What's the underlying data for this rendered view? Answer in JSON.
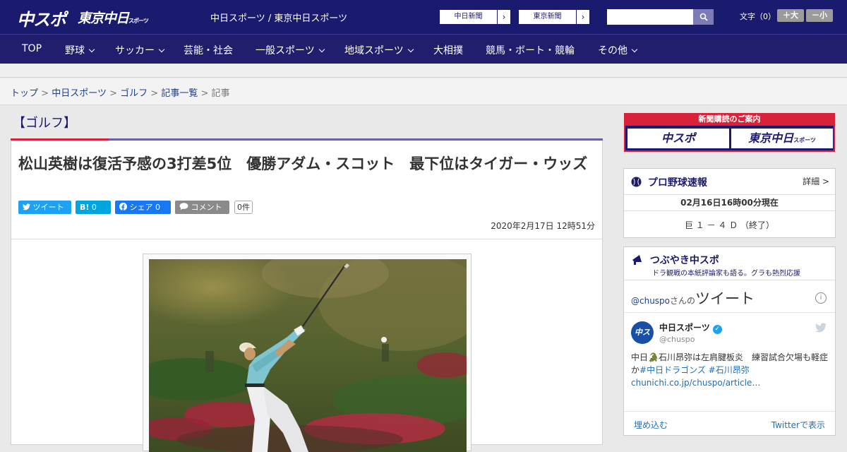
{
  "header": {
    "logo_main": "中スポ",
    "logo_tokyo": "東京中日",
    "logo_tokyo_small": "スポーツ",
    "tagline": "中日スポーツ / 東京中日スポーツ",
    "newspaper_buttons": [
      {
        "label": "中日新聞",
        "arrow": "›"
      },
      {
        "label": "東京新聞",
        "arrow": "›"
      }
    ],
    "search_placeholder": "",
    "font_size_label": "文字（0）",
    "font_larger": "＋大",
    "font_smaller": "－小"
  },
  "nav": {
    "items": [
      {
        "label": "TOP",
        "dropdown": false
      },
      {
        "label": "野球",
        "dropdown": true
      },
      {
        "label": "サッカー",
        "dropdown": true
      },
      {
        "label": "芸能・社会",
        "dropdown": false
      },
      {
        "label": "一般スポーツ",
        "dropdown": true
      },
      {
        "label": "地域スポーツ",
        "dropdown": true
      },
      {
        "label": "大相撲",
        "dropdown": false
      },
      {
        "label": "競馬・ボート・競輪",
        "dropdown": false
      },
      {
        "label": "その他",
        "dropdown": true
      }
    ]
  },
  "breadcrumb": {
    "items": [
      "トップ",
      "中日スポーツ",
      "ゴルフ",
      "記事一覧"
    ],
    "current": "記事",
    "separator": ">"
  },
  "article": {
    "category": "【ゴルフ】",
    "headline": "松山英樹は復活予感の3打差5位　優勝アダム・スコット　最下位はタイガー・ウッズ",
    "share": {
      "tweet": "ツイート",
      "hatena": "0",
      "facebook": "シェア 0",
      "comment": "コメント",
      "comment_count": "0件"
    },
    "date": "2020年2月17日 12時51分"
  },
  "sidebar": {
    "ad_header": "新聞購読のご案内",
    "ad_left": "中スポ",
    "ad_right": "東京中日",
    "ad_right_small": "スポーツ",
    "baseball": {
      "title": "プロ野球速報",
      "more": "詳細 >",
      "as_of": "02月16日16時00分現在",
      "score": "巨 １ － ４ Ｄ （終了）"
    },
    "tweets": {
      "title": "つぶやき中スポ",
      "subtitle": "ドラ観戦の本紙評論家も語る。グラも熱烈応援",
      "handle_prefix": "@chuspo",
      "handle_suffix": "さんの",
      "heading": "ツイート",
      "info": "i",
      "user_name": "中日スポーツ",
      "user_handle": "@chuspo",
      "avatar_text": "中スポ",
      "text": "中日🐊石川昂弥は左肩腱板炎　練習試合欠場も軽症か",
      "hashtags": "#中日ドラゴンズ #石川昂弥",
      "link": "chunichi.co.jp/chuspo/article…",
      "embed": "埋め込む",
      "view": "Twitterで表示"
    }
  },
  "colors": {
    "brand_navy": "#1a1a6e",
    "accent_red": "#d9213a",
    "accent_purple": "#6a5fa8",
    "twitter_blue": "#1da1f2",
    "hatena_blue": "#00a4de",
    "facebook_blue": "#1877f2"
  }
}
